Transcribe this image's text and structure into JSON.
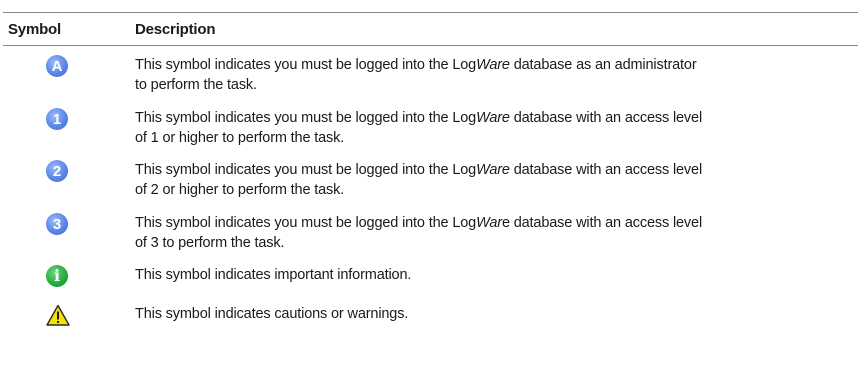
{
  "header": {
    "symbol_label": "Symbol",
    "description_label": "Description"
  },
  "rows": [
    {
      "icon": "admin-icon",
      "icon_text": "A",
      "color": "#4f7ee0",
      "line1_pre": "This symbol indicates you must be logged into the Log",
      "line1_italic": "Ware",
      "line1_post": " database as an administrator",
      "line2": "to perform the task."
    },
    {
      "icon": "access-level-1-icon",
      "icon_text": "1",
      "color": "#4f7ee0",
      "line1_pre": "This symbol indicates you must be logged into the Log",
      "line1_italic": "Ware",
      "line1_post": " database with an access level",
      "line2": "of 1 or higher to perform the task."
    },
    {
      "icon": "access-level-2-icon",
      "icon_text": "2",
      "color": "#4f7ee0",
      "line1_pre": "This symbol indicates you must be logged into the Log",
      "line1_italic": "Ware",
      "line1_post": " database with an access level",
      "line2": "of 2 or higher to perform the task."
    },
    {
      "icon": "access-level-3-icon",
      "icon_text": "3",
      "color": "#4f7ee0",
      "line1_pre": "This symbol indicates you must be logged into the Log",
      "line1_italic": "War",
      "line1_post": "e database with an access level",
      "line2": "of 3 to perform the task."
    },
    {
      "icon": "info-icon",
      "icon_text": "i",
      "color": "#24a83c",
      "line1_pre": "This symbol indicates important information.",
      "line1_italic": "",
      "line1_post": "",
      "line2": ""
    },
    {
      "icon": "warning-icon",
      "icon_text": "!",
      "color": "#f5e400",
      "line1_pre": "This symbol indicates cautions or warnings.",
      "line1_italic": "",
      "line1_post": "",
      "line2": ""
    }
  ]
}
